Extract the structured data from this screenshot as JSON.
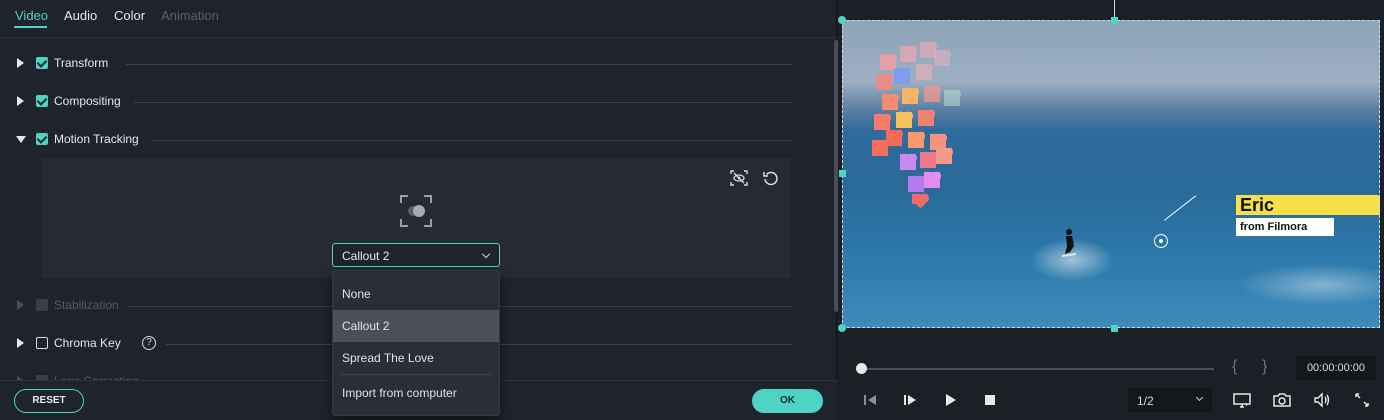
{
  "tabs": [
    {
      "label": "Video",
      "state": "active"
    },
    {
      "label": "Audio",
      "state": "normal"
    },
    {
      "label": "Color",
      "state": "normal"
    },
    {
      "label": "Animation",
      "state": "disabled"
    }
  ],
  "sections": {
    "transform": {
      "label": "Transform",
      "checked": true,
      "expanded": false
    },
    "compositing": {
      "label": "Compositing",
      "checked": true,
      "expanded": false
    },
    "motion_tracking": {
      "label": "Motion Tracking",
      "checked": true,
      "expanded": true
    },
    "stabilization": {
      "label": "Stabilization",
      "checked": false,
      "expanded": false,
      "disabled": true
    },
    "chroma_key": {
      "label": "Chroma Key",
      "checked": false,
      "expanded": false,
      "help": "?"
    },
    "lens_correction": {
      "label": "Lens Correction",
      "checked": false,
      "expanded": false,
      "disabled": true
    }
  },
  "motion_tracking": {
    "selected_element": "Callout 2",
    "options": [
      "None",
      "Callout 2",
      "Spread The Love",
      "Import from computer"
    ]
  },
  "buttons": {
    "reset": "RESET",
    "ok": "OK"
  },
  "preview": {
    "callout_title": "Eric",
    "callout_subtitle": "from Filmora"
  },
  "playback": {
    "timecode": "00:00:00:00",
    "mark_in": "{",
    "mark_out": "}",
    "ratio": "1/2",
    "progress_fraction": 0.0
  },
  "colors": {
    "accent": "#4fd3c4",
    "callout_yellow": "#f5e04a"
  }
}
